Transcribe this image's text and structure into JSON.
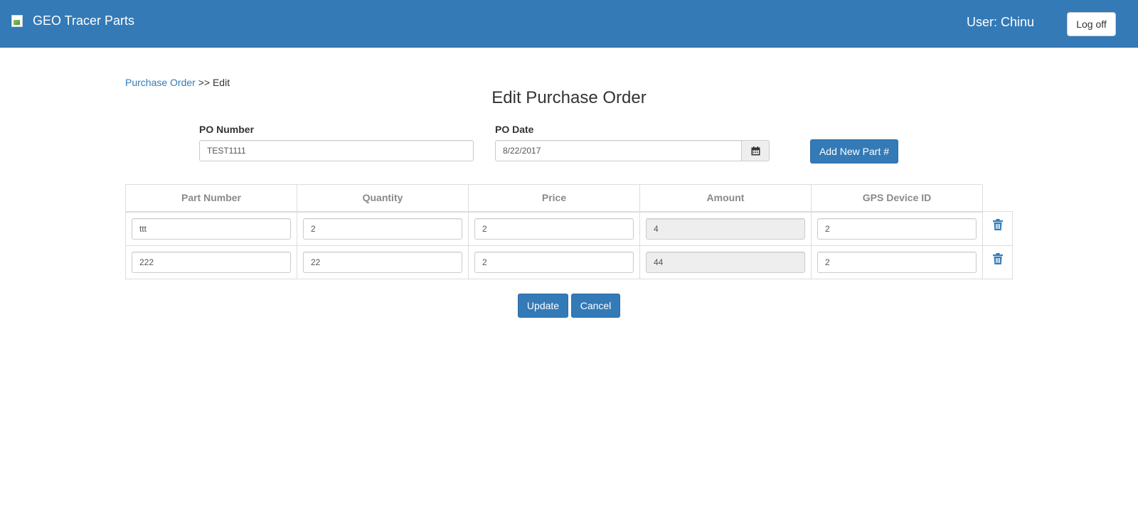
{
  "header": {
    "brand": "GEO Tracer Parts",
    "user_label": "User: Chinu",
    "logoff_label": "Log off"
  },
  "breadcrumb": {
    "parent": "Purchase Order",
    "separator": " >> ",
    "current": "Edit"
  },
  "page": {
    "title": "Edit Purchase Order"
  },
  "form": {
    "po_number_label": "PO Number",
    "po_number_value": "TEST1111",
    "po_date_label": "PO Date",
    "po_date_value": "8/22/2017",
    "add_part_label": "Add New Part #"
  },
  "table": {
    "columns": [
      "Part Number",
      "Quantity",
      "Price",
      "Amount",
      "GPS Device ID"
    ],
    "rows": [
      {
        "part_number": "ttt",
        "quantity": "2",
        "price": "2",
        "amount": "4",
        "gps_device_id": "2"
      },
      {
        "part_number": "222",
        "quantity": "22",
        "price": "2",
        "amount": "44",
        "gps_device_id": "2"
      }
    ]
  },
  "actions": {
    "update_label": "Update",
    "cancel_label": "Cancel"
  },
  "icons": {
    "calendar": "calendar-icon",
    "delete": "trash-icon"
  },
  "colors": {
    "primary": "#337ab7",
    "header_text": "#ffffff",
    "link": "#337ab7"
  }
}
